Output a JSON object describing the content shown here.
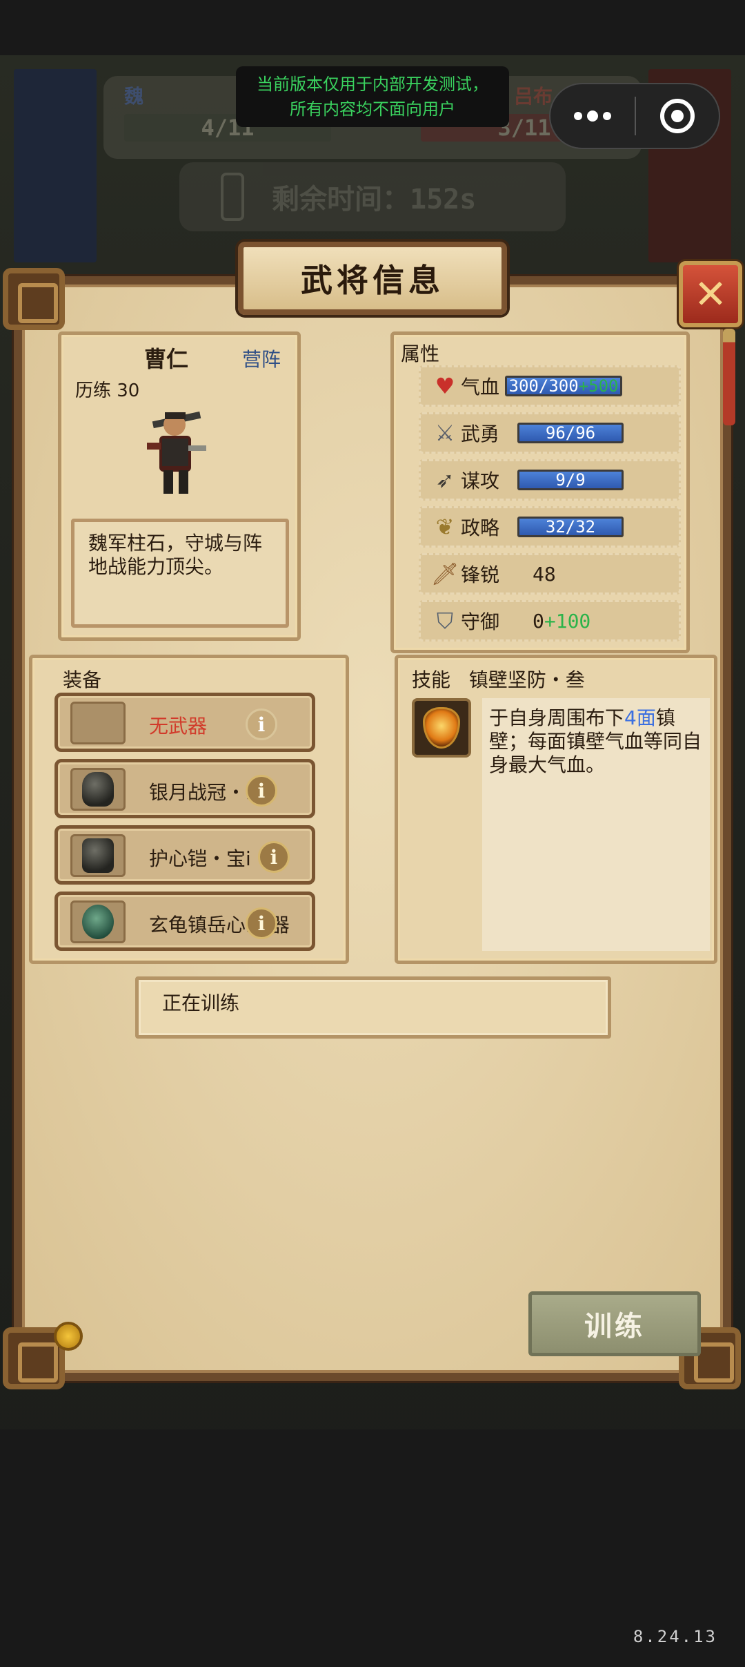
{
  "toast": {
    "line1": "当前版本仅用于内部开发测试，",
    "line2": "所有内容均不面向用户"
  },
  "background": {
    "left_label": "魏",
    "right_label": "吕布",
    "left_progress": "4/11",
    "right_progress": "3/11",
    "timer": "剩余时间：152s"
  },
  "dialog": {
    "title": "武将信息",
    "close_label": "✕"
  },
  "hero": {
    "name": "曹仁",
    "camp": "营阵",
    "experience": "历练 30",
    "description": "魏军柱石，守城与阵地战能力顶尖。"
  },
  "attributes": {
    "header": "属性",
    "hp": {
      "label": "气血",
      "value": "300/300",
      "bonus": "+500",
      "icon": "heart-icon"
    },
    "valor": {
      "label": "武勇",
      "value": "96/96",
      "icon": "crossed-swords-icon"
    },
    "strategy_attack": {
      "label": "谋攻",
      "value": "9/9",
      "icon": "bow-icon"
    },
    "tactics": {
      "label": "政略",
      "value": "32/32",
      "icon": "wheat-icon"
    },
    "sharpness": {
      "label": "锋锐",
      "value": "48",
      "icon": "sword-icon"
    },
    "defense": {
      "label": "守御",
      "value": "0",
      "bonus": "+100",
      "icon": "shield-icon"
    }
  },
  "equipment": {
    "header": "装备",
    "slots": [
      {
        "name": "无武器",
        "empty": true
      },
      {
        "name": "银月战冠・i器",
        "icon": "helmet-icon"
      },
      {
        "name": "护心铠・宝i",
        "icon": "armor-icon"
      },
      {
        "name": "玄龟镇岳心i宝器",
        "icon": "turtle-icon"
      }
    ],
    "info_label": "i"
  },
  "skill": {
    "header": "技能",
    "name": "镇壁坚防・叁",
    "desc_before": "于自身周围布下",
    "desc_highlight": "4面",
    "desc_after": "镇壁；每面镇壁气血等同自身最大气血。",
    "icon": "shield-skill-icon"
  },
  "training": {
    "status": "正在训练",
    "button_label": "训练"
  },
  "version": "8.24.13",
  "colors": {
    "accent_blue": "#3b6fe0",
    "bonus_green": "#2bb34a",
    "warning_red": "#d13a2a",
    "panel": "#e2cea4",
    "frame": "#6b4a2c"
  }
}
